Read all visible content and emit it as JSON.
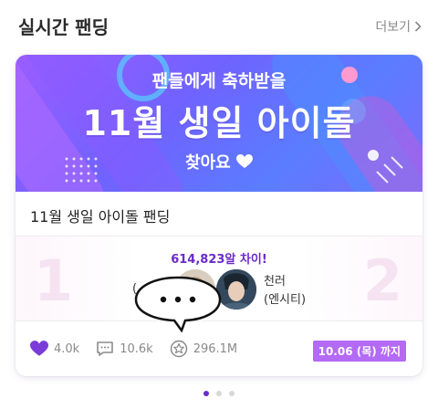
{
  "header": {
    "title": "실시간 팬딩",
    "more_label": "더보기"
  },
  "banner": {
    "line1": "팬들에게 축하받을",
    "line2": "11월 생일 아이돌",
    "line3": "찾아요"
  },
  "card": {
    "title": "11월 생일 아이돌 팬딩",
    "rank_left": "1",
    "rank_right": "2",
    "gap_text": "614,823알 차이!",
    "left_name_fragment": "(",
    "right_name": "천러",
    "right_group": "(엔시티)"
  },
  "stats": {
    "likes": "4.0k",
    "comments": "10.6k",
    "points": "296.1M"
  },
  "deadline": "10.06 (목) 까지",
  "pagination": {
    "count": 3,
    "active_index": 0
  },
  "colors": {
    "accent_purple": "#6a2bc9",
    "badge_purple": "#b36af5",
    "heart_purple": "#7a3bd8"
  }
}
